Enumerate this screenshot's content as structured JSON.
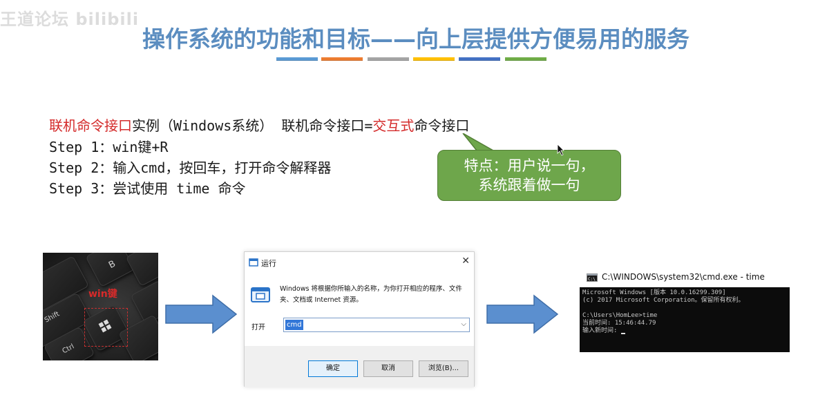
{
  "watermark": "王道论坛 bilibili",
  "slide_title": "操作系统的功能和目标——向上层提供方便易用的服务",
  "title_bar_colors": [
    "#5b9bd5",
    "#ed7d31",
    "#a5a5a5",
    "#ffc000",
    "#4472c4",
    "#70ad47"
  ],
  "content": {
    "line1": {
      "red_part": "联机命令接口",
      "mid_part": "实例（Windows系统）  联机命令接口=",
      "red_part2": "交互式",
      "tail_part": "命令接口"
    },
    "step1": "Step 1：win键+R",
    "step2": "Step 2：输入cmd，按回车，打开命令解释器",
    "step3": "Step 3：尝试使用 time 命令"
  },
  "callout": {
    "line1": "特点：用户说一句，",
    "line2": "系统跟着做一句",
    "color": "#6ea64b"
  },
  "keyboard_photo": {
    "win_label": "win键",
    "keys": [
      "Shift",
      "Ctrl",
      "B"
    ]
  },
  "run_dialog": {
    "title": "运行",
    "description": "Windows 将根据你所输入的名称，为你打开相应的程序、文件夹、文档或 Internet 资源。",
    "open_label": "打开",
    "input_value": "cmd",
    "ok_button": "确定",
    "cancel_button": "取消",
    "browse_button": "浏览(B)..."
  },
  "cmd_window": {
    "title": "C:\\WINDOWS\\system32\\cmd.exe - time",
    "lines": [
      "Microsoft Windows [版本 10.0.16299.309]",
      "(c) 2017 Microsoft Corporation。保留所有权利。",
      "",
      "C:\\Users\\HomLee>time",
      "当前时间: 15:46:44.79",
      "输入新时间: "
    ]
  }
}
